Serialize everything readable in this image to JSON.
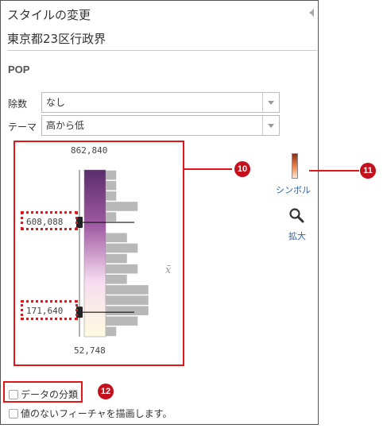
{
  "panel": {
    "title": "スタイルの変更",
    "layer_name": "東京都23区行政界",
    "attribute": "POP"
  },
  "fields": {
    "divide_label": "除数",
    "divide_value": "なし",
    "theme_label": "テーマ",
    "theme_value": "高から低"
  },
  "histogram": {
    "max_label": "862,840",
    "min_label": "52,748",
    "upper_break": "608,088",
    "lower_break": "171,640",
    "mean_symbol": "x̄",
    "max_value": 862840,
    "min_value": 52748,
    "upper_break_value": 608088,
    "lower_break_value": 171640,
    "mean_value": 339000,
    "bin_counts": [
      1,
      1,
      1,
      3,
      1,
      0,
      2,
      3,
      2,
      3,
      2,
      4,
      4,
      4,
      3,
      1
    ],
    "ramp_colors": [
      "#5a2d6b",
      "#a05aa3",
      "#f5dcf0",
      "#fffbe0"
    ]
  },
  "symbol": {
    "link_label": "シンボル",
    "icon": "color-ramp-swatch"
  },
  "zoom": {
    "link_label": "拡大",
    "icon": "magnifier-icon"
  },
  "options": {
    "classify_label": "データの分類",
    "classify_checked": false,
    "draw_nodata_label": "値のないフィーチャを描画します。",
    "draw_nodata_checked": false
  },
  "callouts": {
    "histogram_badge": "10",
    "symbol_badge": "11",
    "classify_badge": "12"
  },
  "colors": {
    "callout_red": "#e0161b",
    "badge_red": "#c4101c",
    "link_blue": "#2b63a6"
  }
}
